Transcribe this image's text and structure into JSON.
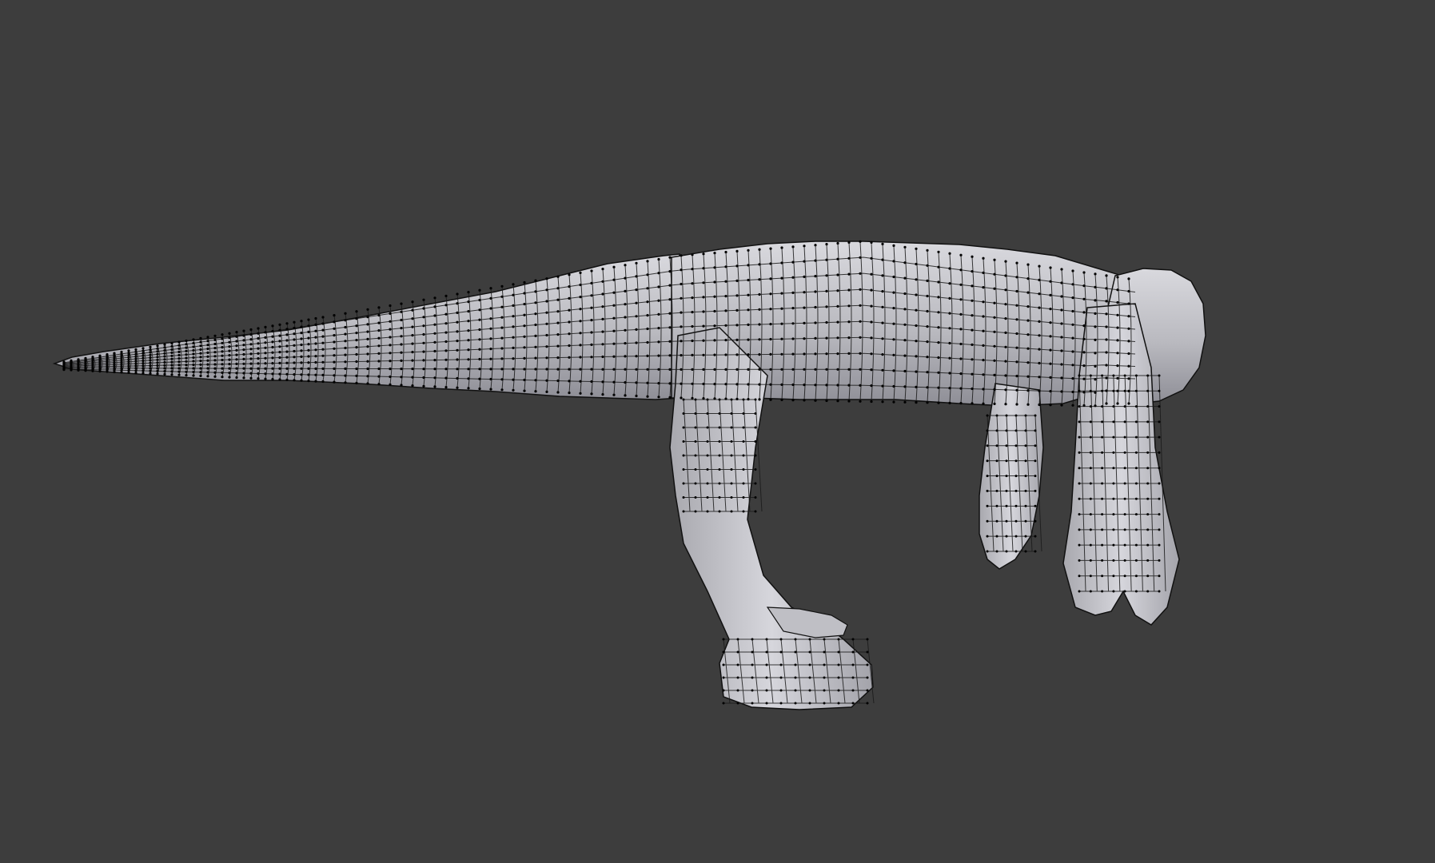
{
  "viewport": {
    "background_color": "#3d3d3d",
    "shading_mode": "solid",
    "overlay": "wireframe",
    "object": {
      "kind": "creature-mesh",
      "parts": [
        "tail",
        "body",
        "head",
        "hind-leg",
        "front-leg-left",
        "front-leg-right"
      ],
      "mesh_fill_color": "#c7c7cd",
      "mesh_shadow_color": "#8e8e96",
      "wire_color": "#1a1a1a",
      "vertex_color": "#000000"
    }
  }
}
